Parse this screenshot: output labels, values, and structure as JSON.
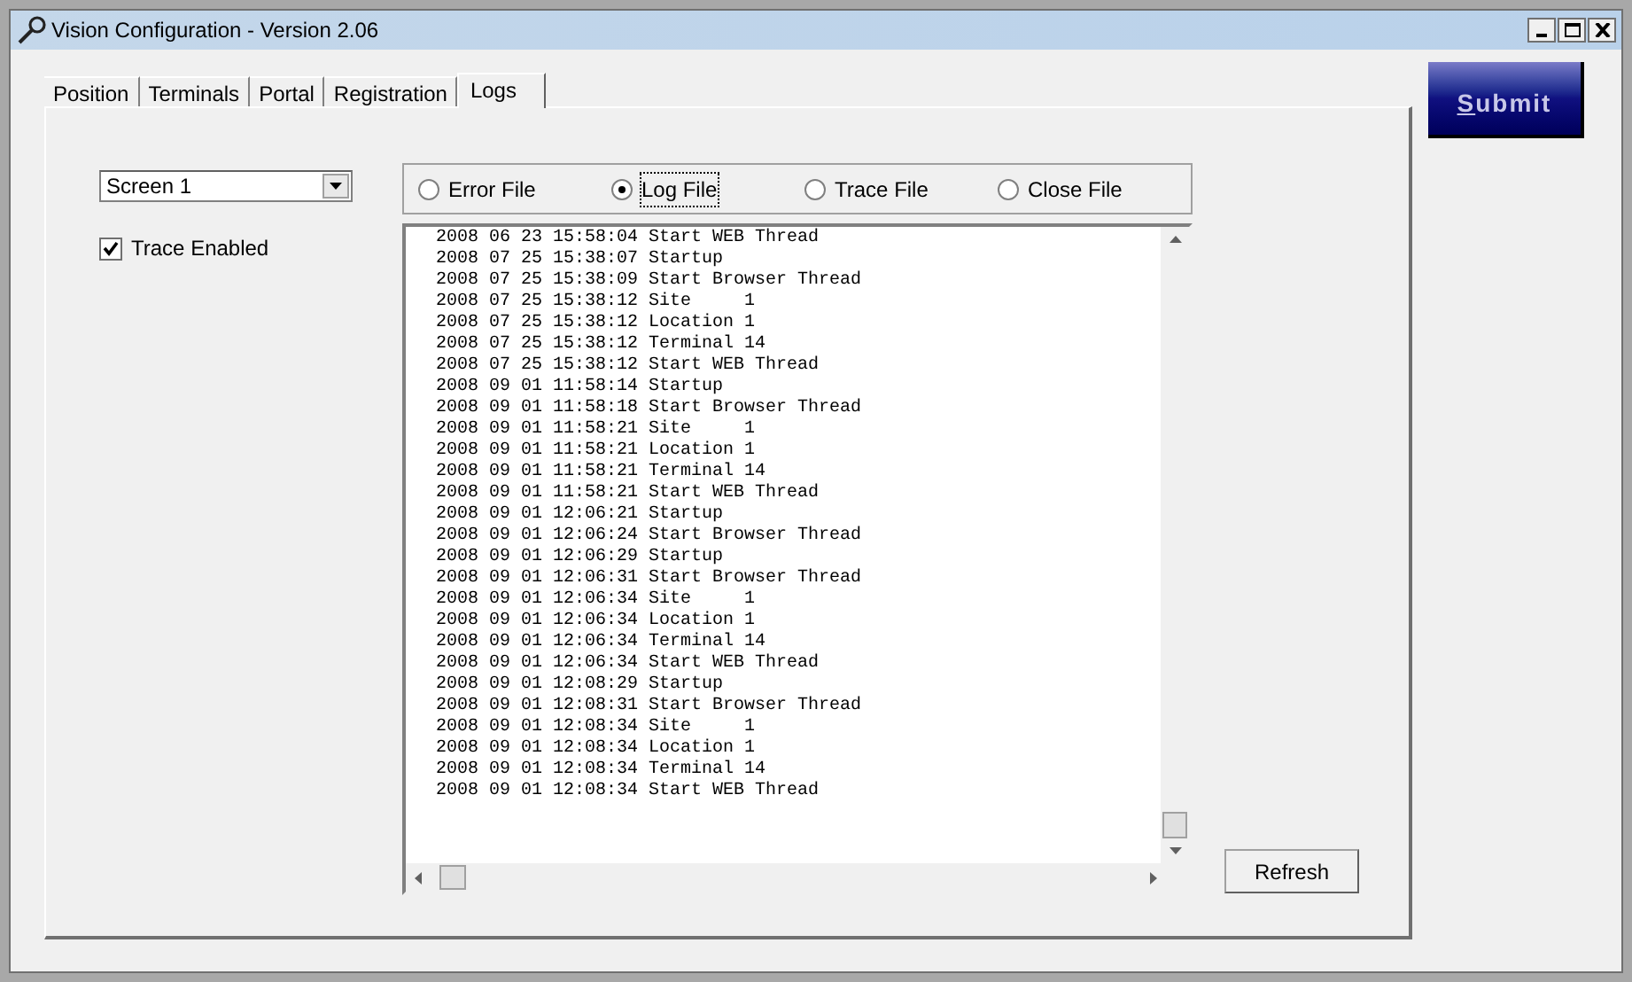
{
  "window": {
    "title": "Vision Configuration - Version 2.06"
  },
  "tabs": [
    {
      "label": "Position",
      "selected": false
    },
    {
      "label": "Terminals",
      "selected": false
    },
    {
      "label": "Portal",
      "selected": false
    },
    {
      "label": "Registration",
      "selected": false
    },
    {
      "label": "Logs",
      "selected": true
    }
  ],
  "screen_select": {
    "value": "Screen 1"
  },
  "trace_enabled": {
    "label": "Trace Enabled",
    "checked": true
  },
  "file_options": [
    {
      "label": "Error File",
      "selected": false
    },
    {
      "label": "Log File",
      "selected": true
    },
    {
      "label": "Trace File",
      "selected": false
    },
    {
      "label": "Close File",
      "selected": false
    }
  ],
  "log_lines": [
    "2008 06 23 15:58:04 Start WEB Thread",
    "2008 07 25 15:38:07 Startup",
    "2008 07 25 15:38:09 Start Browser Thread",
    "2008 07 25 15:38:12 Site     1",
    "2008 07 25 15:38:12 Location 1",
    "2008 07 25 15:38:12 Terminal 14",
    "2008 07 25 15:38:12 Start WEB Thread",
    "2008 09 01 11:58:14 Startup",
    "2008 09 01 11:58:18 Start Browser Thread",
    "2008 09 01 11:58:21 Site     1",
    "2008 09 01 11:58:21 Location 1",
    "2008 09 01 11:58:21 Terminal 14",
    "2008 09 01 11:58:21 Start WEB Thread",
    "2008 09 01 12:06:21 Startup",
    "2008 09 01 12:06:24 Start Browser Thread",
    "2008 09 01 12:06:29 Startup",
    "2008 09 01 12:06:31 Start Browser Thread",
    "2008 09 01 12:06:34 Site     1",
    "2008 09 01 12:06:34 Location 1",
    "2008 09 01 12:06:34 Terminal 14",
    "2008 09 01 12:06:34 Start WEB Thread",
    "2008 09 01 12:08:29 Startup",
    "2008 09 01 12:08:31 Start Browser Thread",
    "2008 09 01 12:08:34 Site     1",
    "2008 09 01 12:08:34 Location 1",
    "2008 09 01 12:08:34 Terminal 14",
    "2008 09 01 12:08:34 Start WEB Thread"
  ],
  "buttons": {
    "refresh": "Refresh",
    "submit_mnemonic": "S",
    "submit_rest": "ubmit"
  }
}
